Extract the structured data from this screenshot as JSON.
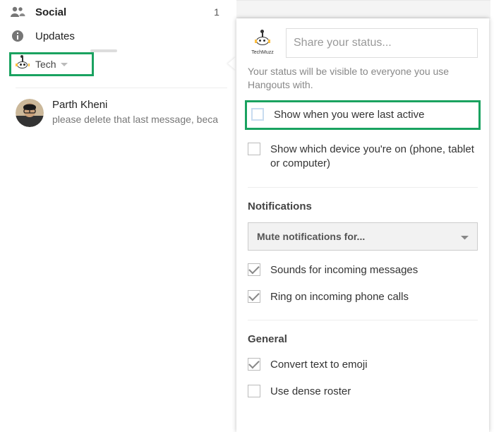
{
  "categories": {
    "social": {
      "label": "Social",
      "count": "1"
    },
    "updates": {
      "label": "Updates"
    }
  },
  "profile": {
    "name": "Tech",
    "brand_label": "TechMuzz"
  },
  "contact": {
    "name": "Parth Kheni",
    "message": "please delete that last message, beca"
  },
  "panel": {
    "brand_label": "TechMuzz",
    "status_placeholder": "Share your status...",
    "status_hint": "Your status will be visible to everyone you use Hangouts with.",
    "opt_last_active": "Show when you were last active",
    "opt_device": "Show which device you're on (phone, tablet or computer)",
    "section_notifications": "Notifications",
    "mute_label": "Mute notifications for...",
    "opt_sounds": "Sounds for incoming messages",
    "opt_ring": "Ring on incoming phone calls",
    "section_general": "General",
    "opt_emoji": "Convert text to emoji",
    "opt_dense": "Use dense roster"
  }
}
